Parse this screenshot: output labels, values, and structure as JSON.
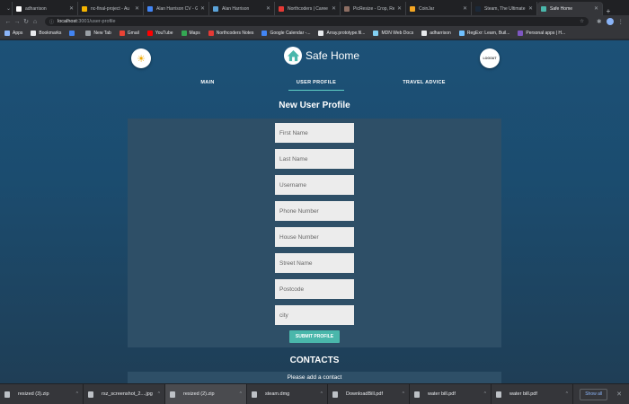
{
  "browser": {
    "tabs": [
      {
        "label": "adharrison",
        "color": "#ffffff",
        "active": false
      },
      {
        "label": "nc-final-project - Au",
        "color": "#f5b400",
        "active": false
      },
      {
        "label": "Alan Harrison CV - G",
        "color": "#4285f4",
        "active": false
      },
      {
        "label": "Alan Harrison",
        "color": "#5ba3d9",
        "active": false
      },
      {
        "label": "Northcoders | Caree",
        "color": "#e53935",
        "active": false
      },
      {
        "label": "PicResize - Crop, Re",
        "color": "#8d6e63",
        "active": false
      },
      {
        "label": "CoinJar",
        "color": "#f4a623",
        "active": false
      },
      {
        "label": "Steam, The Ultimate",
        "color": "#1b2838",
        "active": false
      },
      {
        "label": "Safe Home",
        "color": "#4ab7ab",
        "active": true
      }
    ],
    "address": {
      "host": "localhost",
      "path": ":3001/user-profile"
    },
    "bookmarks": [
      {
        "label": "Apps",
        "color": "#8ab4f8"
      },
      {
        "label": "Bookmarks",
        "color": "#e8eaed"
      },
      {
        "label": "",
        "color": "#4285f4"
      },
      {
        "label": "New Tab",
        "color": "#9aa0a6"
      },
      {
        "label": "Gmail",
        "color": "#ea4335"
      },
      {
        "label": "YouTube",
        "color": "#ff0000"
      },
      {
        "label": "Maps",
        "color": "#34a853"
      },
      {
        "label": "Northcoders Notes",
        "color": "#e53935"
      },
      {
        "label": "Google Calendar -...",
        "color": "#4285f4"
      },
      {
        "label": "Array.prototype.fil...",
        "color": "#e8eaed"
      },
      {
        "label": "MDN Web Docs",
        "color": "#83d0f2"
      },
      {
        "label": "adharrison",
        "color": "#e8eaed"
      },
      {
        "label": "RegExr: Learn, Buil...",
        "color": "#70c1ff"
      },
      {
        "label": "Personal apps | H...",
        "color": "#7e57c2"
      }
    ]
  },
  "app": {
    "name": "Safe Home",
    "logout_label": "LOGOUT",
    "nav": [
      {
        "label": "MAIN",
        "active": false
      },
      {
        "label": "USER PROFILE",
        "active": true
      },
      {
        "label": "TRAVEL ADVICE",
        "active": false
      }
    ],
    "form": {
      "title": "New User Profile",
      "fields": [
        {
          "placeholder": "First Name",
          "value": ""
        },
        {
          "placeholder": "Last Name",
          "value": ""
        },
        {
          "placeholder": "Username",
          "value": ""
        },
        {
          "placeholder": "Phone Number",
          "value": ""
        },
        {
          "placeholder": "House Number",
          "value": ""
        },
        {
          "placeholder": "Street Name",
          "value": ""
        },
        {
          "placeholder": "Postcode",
          "value": ""
        },
        {
          "placeholder": "city",
          "value": ""
        }
      ],
      "submit_label": "SUBMIT PROFILE"
    },
    "contacts": {
      "title": "CONTACTS",
      "empty_message": "Please add a contact"
    },
    "accent_color": "#4ab7ab"
  },
  "downloads": {
    "items": [
      {
        "name": "resized (3).zip"
      },
      {
        "name": "rsz_screenshot_2....jpg"
      },
      {
        "name": "resized (2).zip"
      },
      {
        "name": "steam.dmg"
      },
      {
        "name": "DownloadBill.pdf"
      },
      {
        "name": "water bill.pdf"
      },
      {
        "name": "water bill.pdf"
      }
    ],
    "show_all_label": "Show all"
  }
}
